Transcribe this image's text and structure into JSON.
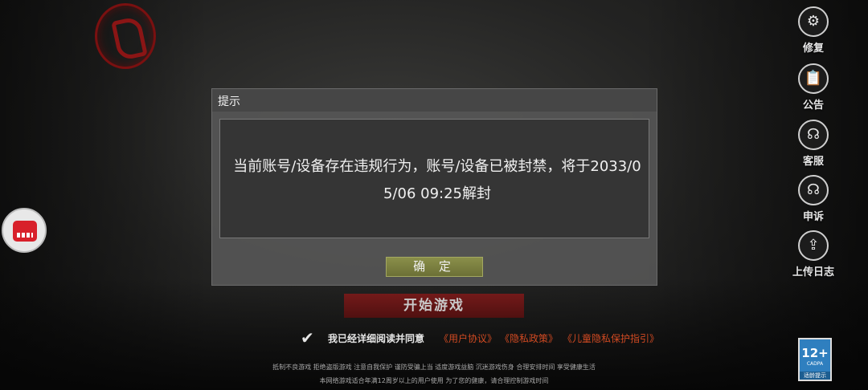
{
  "right_menu": [
    {
      "label": "修复",
      "icon": "repair-icon"
    },
    {
      "label": "公告",
      "icon": "announcement-icon"
    },
    {
      "label": "客服",
      "icon": "customer-service-icon"
    },
    {
      "label": "申诉",
      "icon": "appeal-icon"
    },
    {
      "label": "上传日志",
      "icon": "upload-log-icon"
    }
  ],
  "dialog": {
    "title": "提示",
    "message": "当前账号/设备存在违规行为，账号/设备已被封禁，将于2033/05/06 09:25解封",
    "confirm_label": "确 定"
  },
  "start_button": "开始游戏",
  "agreement": {
    "text": "我已经详细阅读并同意",
    "links": [
      "《用户协议》",
      "《隐私政策》",
      "《儿童隐私保护指引》"
    ]
  },
  "notice_lines": [
    "抵制不良游戏  拒绝盗版游戏  注意自我保护  谨防受骗上当  适度游戏益脑  沉迷游戏伤身  合理安排时间  享受健康生活",
    "本网络游戏适合年满12周岁以上的用户使用    为了您的健康，请合理控制游戏时间"
  ],
  "age_rating": {
    "number": "12+",
    "org": "CADPA",
    "label": "适龄提示"
  }
}
